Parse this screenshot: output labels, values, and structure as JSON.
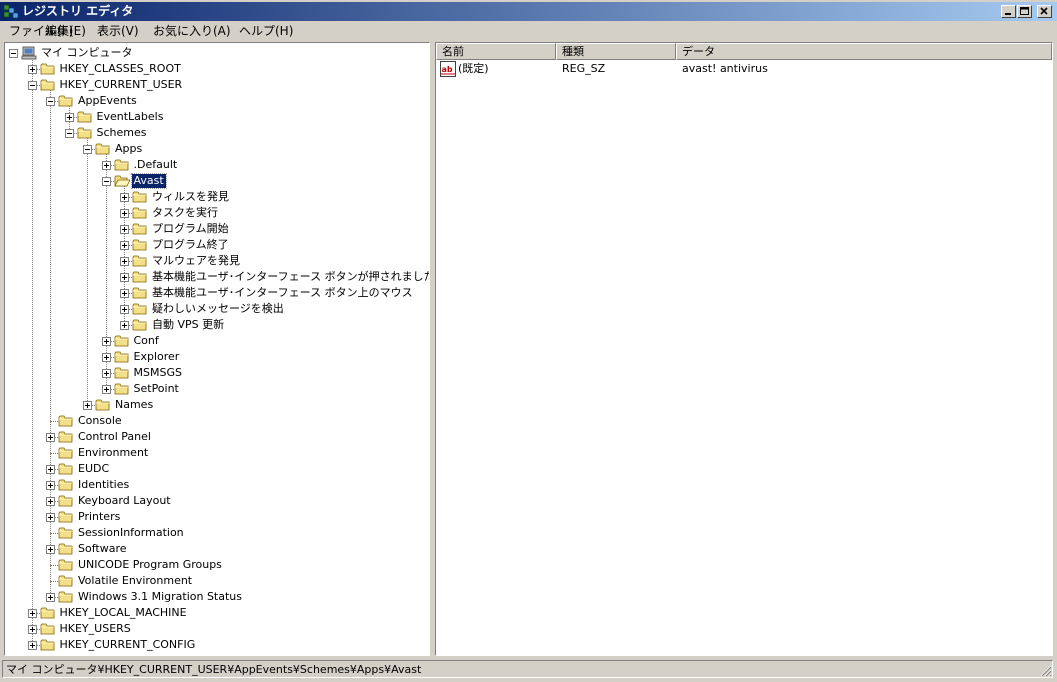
{
  "window": {
    "title": "レジストリ エディタ",
    "minimize_glyph": "_",
    "maximize_glyph": "□",
    "close_glyph": "×"
  },
  "menu": [
    "ファイル(F)",
    "編集(E)",
    "表示(V)",
    "お気に入り(A)",
    "ヘルプ(H)"
  ],
  "tree": [
    {
      "label": "マイ コンピュータ",
      "level": 0,
      "exp": "minus",
      "icon": "computer-icon"
    },
    {
      "label": "HKEY_CLASSES_ROOT",
      "level": 1,
      "exp": "plus"
    },
    {
      "label": "HKEY_CURRENT_USER",
      "level": 1,
      "exp": "minus"
    },
    {
      "label": "AppEvents",
      "level": 2,
      "exp": "minus"
    },
    {
      "label": "EventLabels",
      "level": 3,
      "exp": "plus"
    },
    {
      "label": "Schemes",
      "level": 3,
      "exp": "minus"
    },
    {
      "label": "Apps",
      "level": 4,
      "exp": "minus"
    },
    {
      "label": ".Default",
      "level": 5,
      "exp": "plus"
    },
    {
      "label": "Avast",
      "level": 5,
      "exp": "minus",
      "selected": true,
      "open": true
    },
    {
      "label": "ウィルスを発見",
      "level": 6,
      "exp": "plus"
    },
    {
      "label": "タスクを実行",
      "level": 6,
      "exp": "plus"
    },
    {
      "label": "プログラム開始",
      "level": 6,
      "exp": "plus"
    },
    {
      "label": "プログラム終了",
      "level": 6,
      "exp": "plus"
    },
    {
      "label": "マルウェアを発見",
      "level": 6,
      "exp": "plus"
    },
    {
      "label": "基本機能ユーザ･インターフェース ボタンが押されました",
      "level": 6,
      "exp": "plus"
    },
    {
      "label": "基本機能ユーザ･インターフェース ボタン上のマウス",
      "level": 6,
      "exp": "plus"
    },
    {
      "label": "疑わしいメッセージを検出",
      "level": 6,
      "exp": "plus"
    },
    {
      "label": "自動 VPS 更新",
      "level": 6,
      "exp": "plus"
    },
    {
      "label": "Conf",
      "level": 5,
      "exp": "plus"
    },
    {
      "label": "Explorer",
      "level": 5,
      "exp": "plus"
    },
    {
      "label": "MSMSGS",
      "level": 5,
      "exp": "plus"
    },
    {
      "label": "SetPoint",
      "level": 5,
      "exp": "plus"
    },
    {
      "label": "Names",
      "level": 4,
      "exp": "plus"
    },
    {
      "label": "Console",
      "level": 2,
      "exp": "none"
    },
    {
      "label": "Control Panel",
      "level": 2,
      "exp": "plus"
    },
    {
      "label": "Environment",
      "level": 2,
      "exp": "none"
    },
    {
      "label": "EUDC",
      "level": 2,
      "exp": "plus"
    },
    {
      "label": "Identities",
      "level": 2,
      "exp": "plus"
    },
    {
      "label": "Keyboard Layout",
      "level": 2,
      "exp": "plus"
    },
    {
      "label": "Printers",
      "level": 2,
      "exp": "plus"
    },
    {
      "label": "SessionInformation",
      "level": 2,
      "exp": "none"
    },
    {
      "label": "Software",
      "level": 2,
      "exp": "plus"
    },
    {
      "label": "UNICODE Program Groups",
      "level": 2,
      "exp": "none"
    },
    {
      "label": "Volatile Environment",
      "level": 2,
      "exp": "none"
    },
    {
      "label": "Windows 3.1 Migration Status",
      "level": 2,
      "exp": "plus"
    },
    {
      "label": "HKEY_LOCAL_MACHINE",
      "level": 1,
      "exp": "plus"
    },
    {
      "label": "HKEY_USERS",
      "level": 1,
      "exp": "plus"
    },
    {
      "label": "HKEY_CURRENT_CONFIG",
      "level": 1,
      "exp": "plus"
    }
  ],
  "list": {
    "columns": [
      "名前",
      "種類",
      "データ"
    ],
    "rows": [
      {
        "name": "(既定)",
        "type": "REG_SZ",
        "data": "avast! antivirus",
        "icon": "string-value-icon"
      }
    ]
  },
  "status": "マイ コンピュータ¥HKEY_CURRENT_USER¥AppEvents¥Schemes¥Apps¥Avast",
  "colors": {
    "titlebar_start": "#0a246a",
    "titlebar_end": "#a6caf0",
    "selection": "#0a246a",
    "folder": "#f5e08a"
  }
}
